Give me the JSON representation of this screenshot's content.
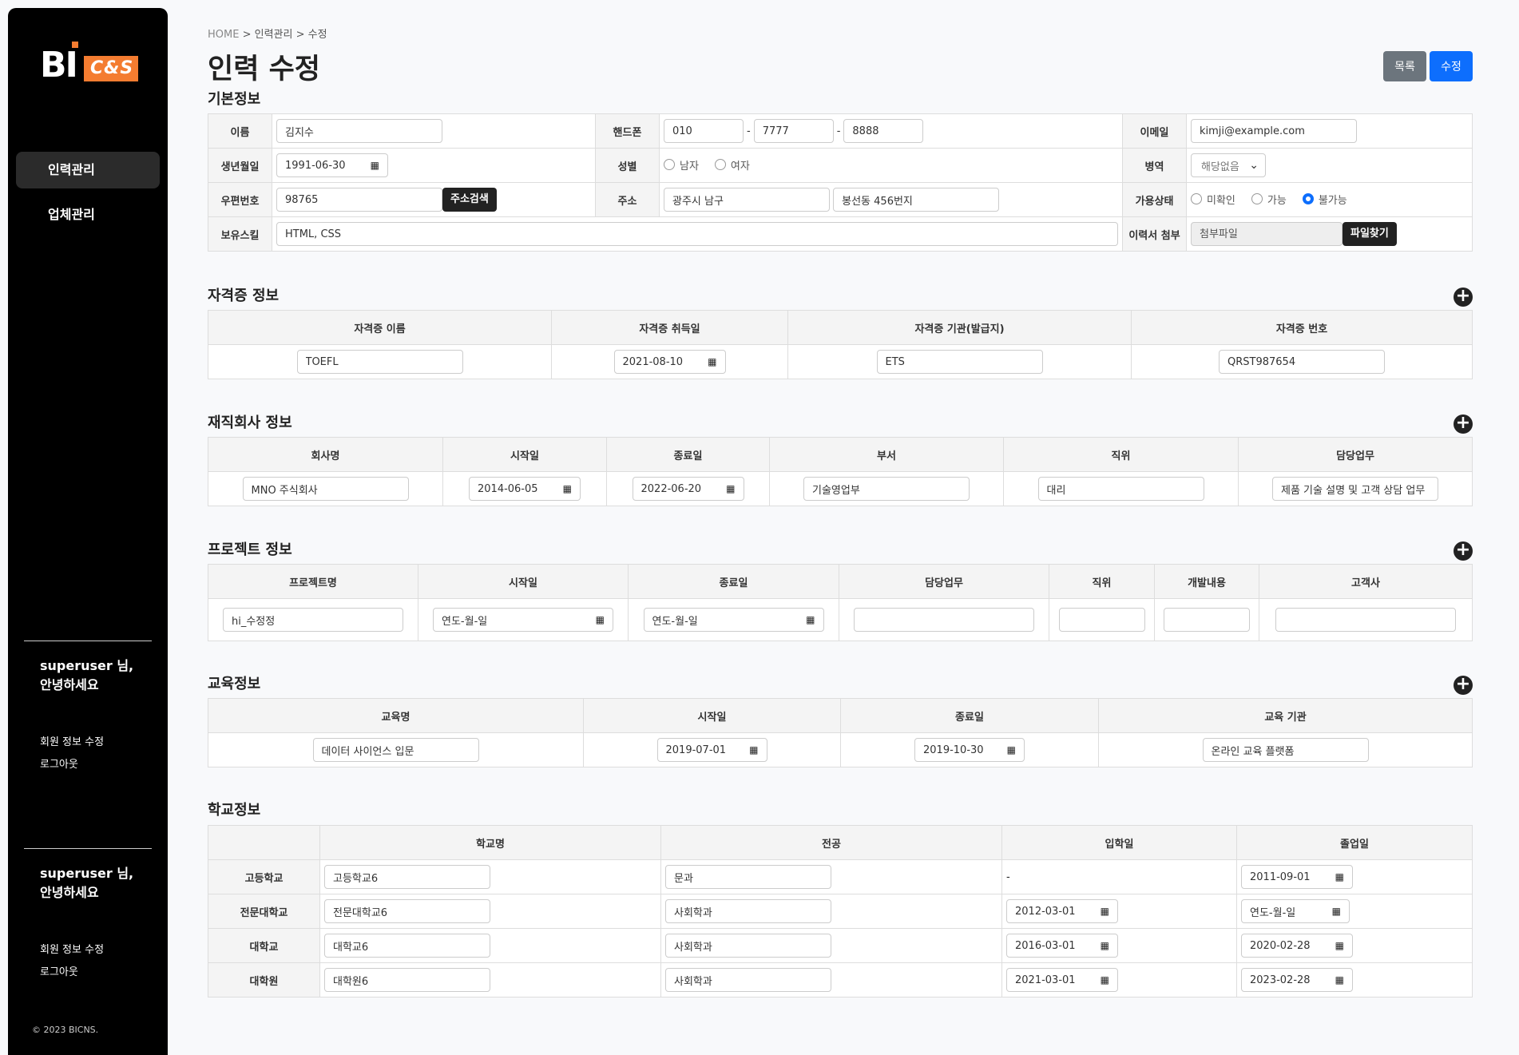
{
  "sidebar": {
    "logo": {
      "bi": "BI",
      "cs": "C&S"
    },
    "nav": [
      {
        "label": "인력관리"
      },
      {
        "label": "업체관리"
      }
    ],
    "greeting1": {
      "user": "superuser 님,",
      "hello": "안녕하세요"
    },
    "links1": {
      "edit": "회원 정보 수정",
      "logout": "로그아웃"
    },
    "greeting2": {
      "user": "superuser 님,",
      "hello": "안녕하세요"
    },
    "links2": {
      "edit": "회원 정보 수정",
      "logout": "로그아웃"
    },
    "copyright": "© 2023 BICNS."
  },
  "breadcrumb": {
    "home": "HOME",
    "sep1": " > ",
    "level1": "인력관리",
    "sep2": " > ",
    "level2": "수정"
  },
  "page_title": "인력 수정",
  "buttons": {
    "list": "목록",
    "edit": "수정"
  },
  "basic": {
    "title": "기본정보",
    "name_label": "이름",
    "name": "김지수",
    "phone_label": "핸드폰",
    "phone1": "010",
    "phone2": "7777",
    "phone3": "8888",
    "dash": "-",
    "email_label": "이메일",
    "email": "kimji@example.com",
    "birth_label": "생년월일",
    "birth": "1991-06-30",
    "gender_label": "성별",
    "gender_male": "남자",
    "gender_female": "여자",
    "military_label": "병역",
    "military": "해당없음",
    "zip_label": "우편번호",
    "zip": "98765",
    "zip_search": "주소검색",
    "addr_label": "주소",
    "addr1": "광주시 남구",
    "addr2": "봉선동 456번지",
    "avail_label": "가용상태",
    "avail_unknown": "미확인",
    "avail_yes": "가능",
    "avail_no": "불가능",
    "skill_label": "보유스킬",
    "skill": "HTML, CSS",
    "resume_label": "이력서 첨부",
    "resume_placeholder": "첨부파일",
    "file_btn": "파일찾기"
  },
  "cert": {
    "title": "자격증 정보",
    "headers": [
      "자격증 이름",
      "자격증 취득일",
      "자격증 기관(발급지)",
      "자격증 번호"
    ],
    "row": {
      "name": "TOEFL",
      "date": "2021-08-10",
      "org": "ETS",
      "no": "QRST987654"
    }
  },
  "company": {
    "title": "재직회사 정보",
    "headers": [
      "회사명",
      "시작일",
      "종료일",
      "부서",
      "직위",
      "담당업무"
    ],
    "row": {
      "name": "MNO 주식회사",
      "start": "2014-06-05",
      "end": "2022-06-20",
      "dept": "기술영업부",
      "pos": "대리",
      "task": "제품 기술 설명 및 고객 상담 업무"
    }
  },
  "project": {
    "title": "프로젝트 정보",
    "headers": [
      "프로젝트명",
      "시작일",
      "종료일",
      "담당업무",
      "직위",
      "개발내용",
      "고객사"
    ],
    "row": {
      "name": "hi_수정정",
      "start": "연도-월-일",
      "end": "연도-월-일"
    }
  },
  "edu": {
    "title": "교육정보",
    "headers": [
      "교육명",
      "시작일",
      "종료일",
      "교육 기관"
    ],
    "row": {
      "name": "데이터 사이언스 입문",
      "start": "2019-07-01",
      "end": "2019-10-30",
      "org": "온라인 교육 플랫폼"
    }
  },
  "school": {
    "title": "학교정보",
    "headers": [
      "학교명",
      "전공",
      "입학일",
      "졸업일"
    ],
    "rows": [
      {
        "type": "고등학교",
        "name": "고등학교6",
        "major": "문과",
        "enter": "-",
        "grad": "2011-09-01"
      },
      {
        "type": "전문대학교",
        "name": "전문대학교6",
        "major": "사회학과",
        "enter": "2012-03-01",
        "grad": "연도-월-일"
      },
      {
        "type": "대학교",
        "name": "대학교6",
        "major": "사회학과",
        "enter": "2016-03-01",
        "grad": "2020-02-28"
      },
      {
        "type": "대학원",
        "name": "대학원6",
        "major": "사회학과",
        "enter": "2021-03-01",
        "grad": "2023-02-28"
      }
    ]
  },
  "icons": {
    "add": "+",
    "calendar": "▦",
    "chevron": "⌄"
  }
}
